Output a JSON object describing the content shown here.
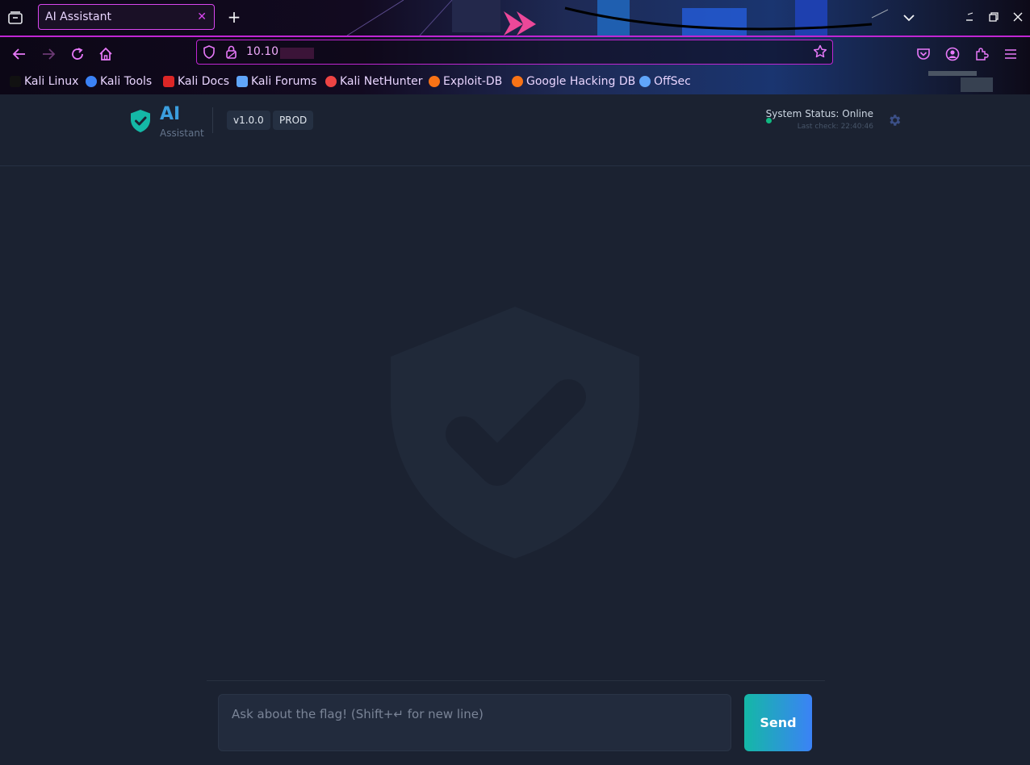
{
  "browser": {
    "tab_title": "AI Assistant",
    "url": "10.10",
    "bookmarks": [
      {
        "label": "Kali Linux",
        "icon": "kali-dragon-icon",
        "color": "#111111"
      },
      {
        "label": "Kali Tools",
        "icon": "kali-tools-icon",
        "color": "#3b82f6"
      },
      {
        "label": "Kali Docs",
        "icon": "kali-docs-icon",
        "color": "#dc2626"
      },
      {
        "label": "Kali Forums",
        "icon": "kali-forums-icon",
        "color": "#60a5fa"
      },
      {
        "label": "Kali NetHunter",
        "icon": "kali-nethunter-icon",
        "color": "#ef4444"
      },
      {
        "label": "Exploit-DB",
        "icon": "exploit-db-icon",
        "color": "#f97316"
      },
      {
        "label": "Google Hacking DB",
        "icon": "ghdb-icon",
        "color": "#f97316"
      },
      {
        "label": "OffSec",
        "icon": "offsec-icon",
        "color": "#60a5fa"
      }
    ]
  },
  "app": {
    "brand": "AI",
    "brand_sub": "Assistant",
    "version": "v1.0.0",
    "env": "PROD",
    "status_text": "System Status: Online",
    "last_check": "Last check: 22:40:46",
    "chat_placeholder": "Ask about the flag! (Shift+↵ for new line)",
    "send_label": "Send"
  },
  "colors": {
    "accent_magenta": "#c026d3",
    "brand_blue": "#3b9ede",
    "shield_teal": "#14b8a6",
    "status_online": "#10b981",
    "page_bg": "#1b2231"
  }
}
